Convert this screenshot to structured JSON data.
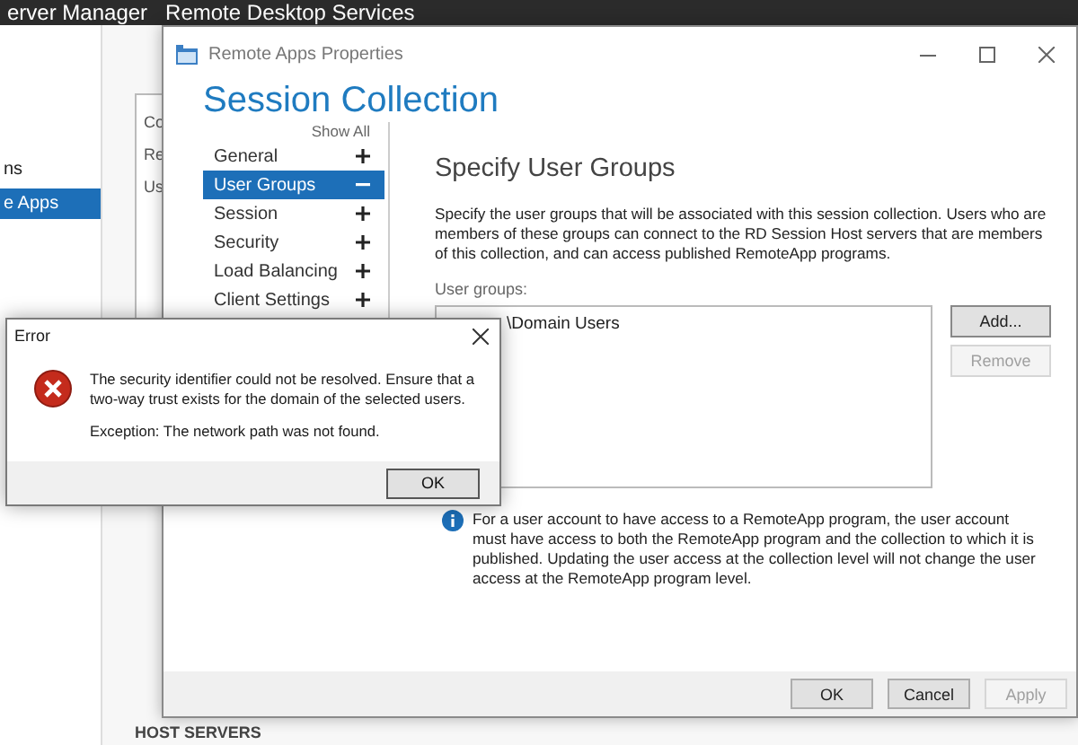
{
  "server_manager": {
    "title": "erver Manager",
    "breadcrumb": "Remote Desktop Services",
    "sidebar": {
      "items": [
        {
          "label": "ns",
          "selected": false
        },
        {
          "label": "e Apps",
          "selected": true
        }
      ]
    },
    "panel_rows": [
      "Co",
      "Re",
      "Us"
    ],
    "section_heading": "HOST SERVERS"
  },
  "properties_dialog": {
    "title": "Remote Apps Properties",
    "heading": "Session Collection",
    "show_all": "Show All",
    "nav": [
      {
        "label": "General",
        "selected": false,
        "expanded": false
      },
      {
        "label": "User Groups",
        "selected": true,
        "expanded": true
      },
      {
        "label": "Session",
        "selected": false,
        "expanded": false
      },
      {
        "label": "Security",
        "selected": false,
        "expanded": false
      },
      {
        "label": "Load Balancing",
        "selected": false,
        "expanded": false
      },
      {
        "label": "Client Settings",
        "selected": false,
        "expanded": false
      }
    ],
    "page_title": "Specify User Groups",
    "description": "Specify the user groups that will be associated with this session collection. Users who are members of these groups can connect to the RD Session Host servers that are members of this collection, and can access published RemoteApp programs.",
    "list_label": "User groups:",
    "user_groups": [
      {
        "name": "\\Domain Users"
      }
    ],
    "side_buttons": [
      {
        "label": "Add...",
        "disabled": false
      },
      {
        "label": "Remove",
        "disabled": true
      }
    ],
    "note": "For a user account to have access to a RemoteApp program, the user account must have access to both the RemoteApp program and the collection to which it is published. Updating the user access at the collection level will not change the user access at the RemoteApp program level.",
    "buttons": [
      {
        "label": "OK",
        "disabled": false
      },
      {
        "label": "Cancel",
        "disabled": false
      },
      {
        "label": "Apply",
        "disabled": true
      }
    ]
  },
  "error_dialog": {
    "title": "Error",
    "message": "The security identifier could not be resolved. Ensure that a two-way trust exists for the domain of the selected users.",
    "exception": "Exception: The network path was not found.",
    "button": "OK"
  }
}
